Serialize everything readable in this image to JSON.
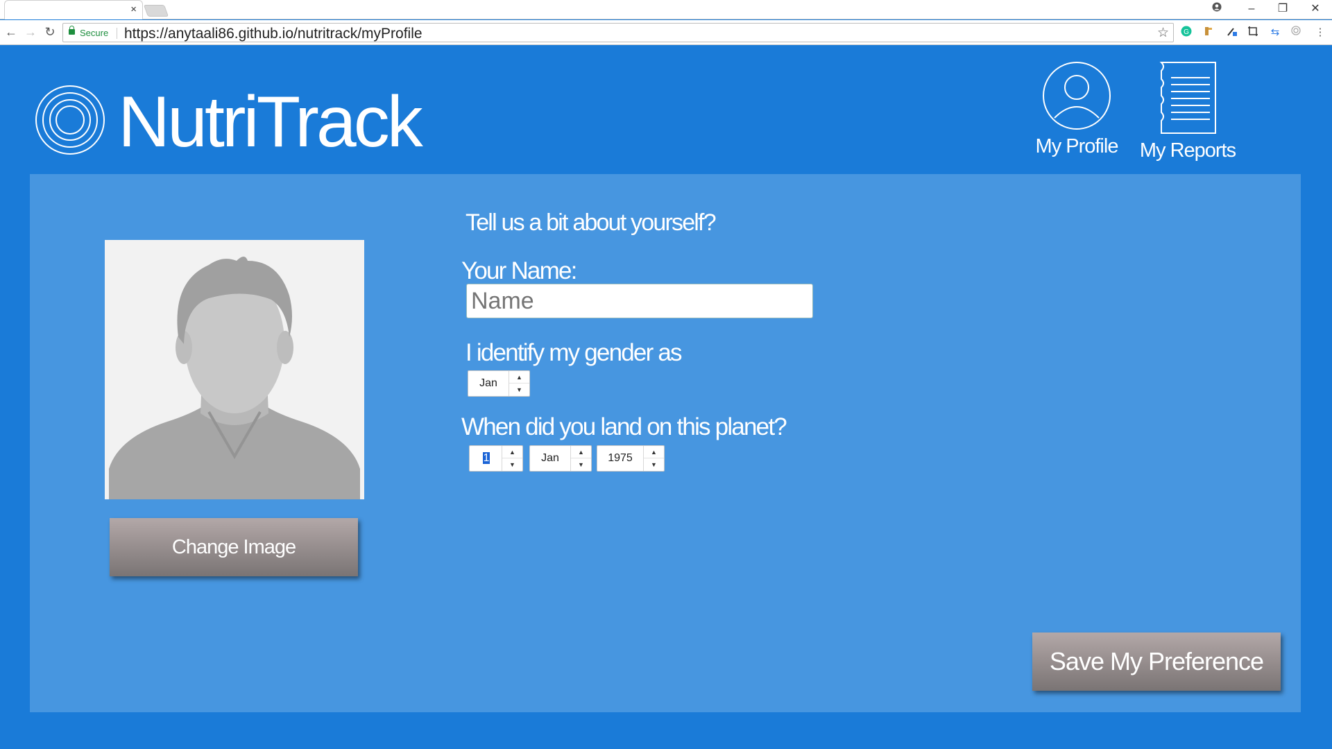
{
  "browser": {
    "tab_close": "×",
    "secure_label": "Secure",
    "url": "https://anytaali86.github.io/nutritrack/myProfile",
    "icons": [
      "back-icon",
      "forward-icon",
      "reload-icon",
      "lock-icon",
      "star-icon",
      "account-icon",
      "minimize-icon",
      "restore-icon",
      "close-icon",
      "menu-icon"
    ]
  },
  "app": {
    "brand": "NutriTrack",
    "nav": {
      "profile": "My Profile",
      "reports": "My Reports"
    }
  },
  "profile": {
    "intro": "Tell us a bit about yourself?",
    "name_label": "Your Name:",
    "name_placeholder": "Name",
    "name_value": "",
    "change_image": "Change Image",
    "gender_label": "I identify my gender as",
    "gender_value": "Jan",
    "birth_label": "When did you land on this planet?",
    "birth_day": "1",
    "birth_month": "Jan",
    "birth_year": "1975",
    "save": "Save My Preference"
  },
  "colors": {
    "background": "#1a7bd8",
    "panel": "#4796e0",
    "button_top": "#b3a8a8",
    "button_bottom": "#7a7474"
  }
}
